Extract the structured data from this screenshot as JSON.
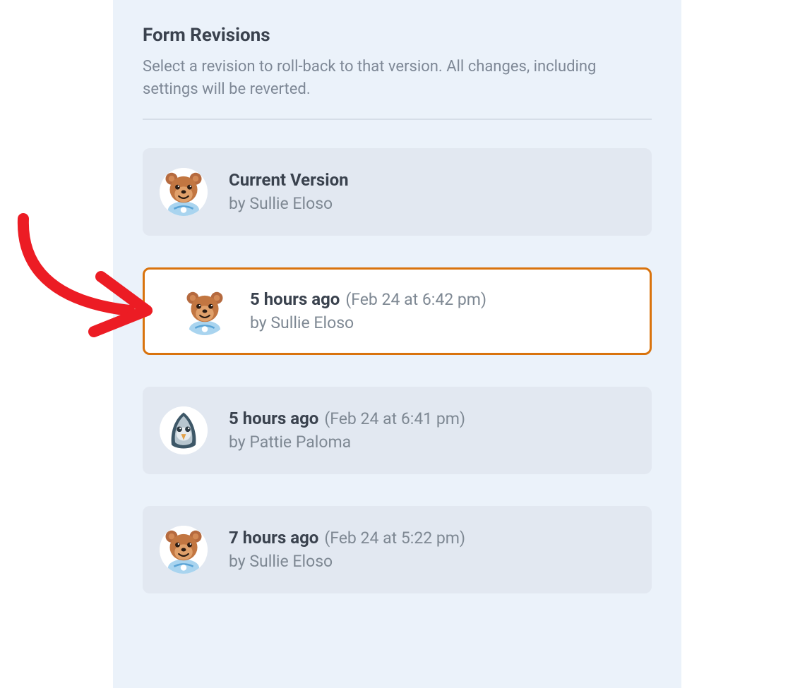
{
  "header": {
    "title": "Form Revisions",
    "description": "Select a revision to roll-back to that version. All changes, including settings will be reverted."
  },
  "revisions": [
    {
      "title": "Current Version",
      "subtime": "",
      "author_prefix": "by ",
      "author": "Sullie Eloso",
      "avatar": "bear",
      "selected": false
    },
    {
      "title": "5 hours ago",
      "subtime": "(Feb 24 at 6:42 pm)",
      "author_prefix": "by ",
      "author": "Sullie Eloso",
      "avatar": "bear",
      "selected": true
    },
    {
      "title": "5 hours ago",
      "subtime": "(Feb 24 at 6:41 pm)",
      "author_prefix": "by ",
      "author": "Pattie Paloma",
      "avatar": "bird",
      "selected": false
    },
    {
      "title": "7 hours ago",
      "subtime": "(Feb 24 at 5:22 pm)",
      "author_prefix": "by ",
      "author": "Sullie Eloso",
      "avatar": "bear",
      "selected": false
    }
  ]
}
